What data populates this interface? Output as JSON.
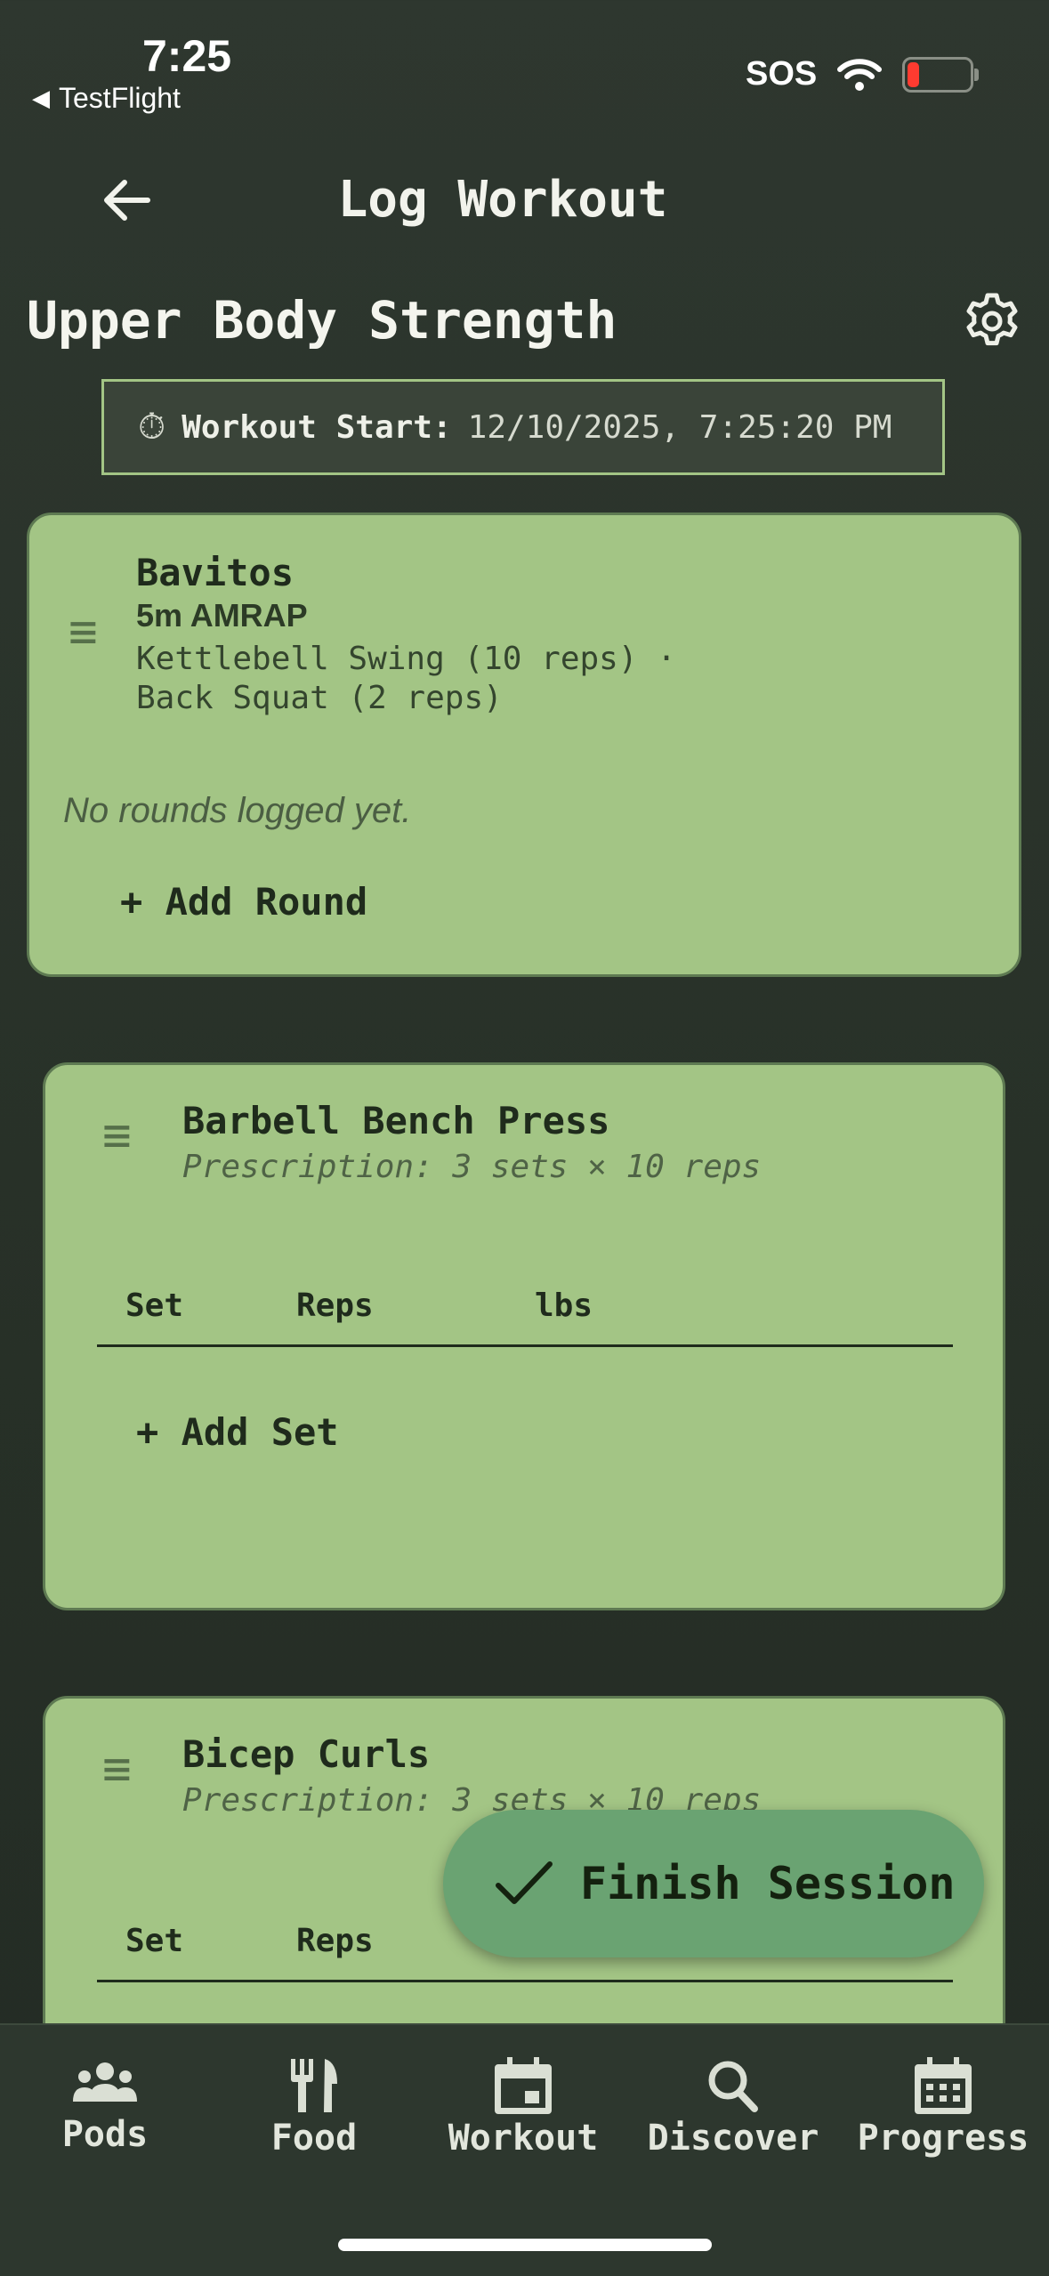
{
  "status_bar": {
    "time": "7:25",
    "back_app": "TestFlight",
    "carrier": "SOS"
  },
  "header": {
    "title": "Log Workout"
  },
  "workout": {
    "name": "Upper Body Strength",
    "start_label": "Workout Start:",
    "start_value": "12/10/2025, 7:25:20 PM"
  },
  "cards": [
    {
      "title": "Bavitos",
      "subtitle": "5m AMRAP",
      "detail_line1": "Kettlebell Swing (10 reps) ·",
      "detail_line2": "Back Squat (2 reps)",
      "empty_text": "No rounds logged yet.",
      "add_label": "+ Add Round"
    },
    {
      "title": "Barbell Bench Press",
      "prescription": "Prescription: 3 sets × 10 reps",
      "columns": [
        "Set",
        "Reps",
        "lbs"
      ],
      "add_label": "+ Add Set"
    },
    {
      "title": "Bicep Curls",
      "prescription": "Prescription: 3 sets × 10 reps",
      "columns": [
        "Set",
        "Reps"
      ]
    }
  ],
  "fab": {
    "label": "Finish Session"
  },
  "nav": [
    {
      "label": "Pods",
      "icon": "people-icon"
    },
    {
      "label": "Food",
      "icon": "utensils-icon"
    },
    {
      "label": "Workout",
      "icon": "calendar-event-icon"
    },
    {
      "label": "Discover",
      "icon": "search-icon"
    },
    {
      "label": "Progress",
      "icon": "calendar-grid-icon"
    }
  ],
  "colors": {
    "card": "#a3c585",
    "fab": "#6aa372",
    "background": "#2b342c",
    "battery_low": "#ff3b30"
  }
}
